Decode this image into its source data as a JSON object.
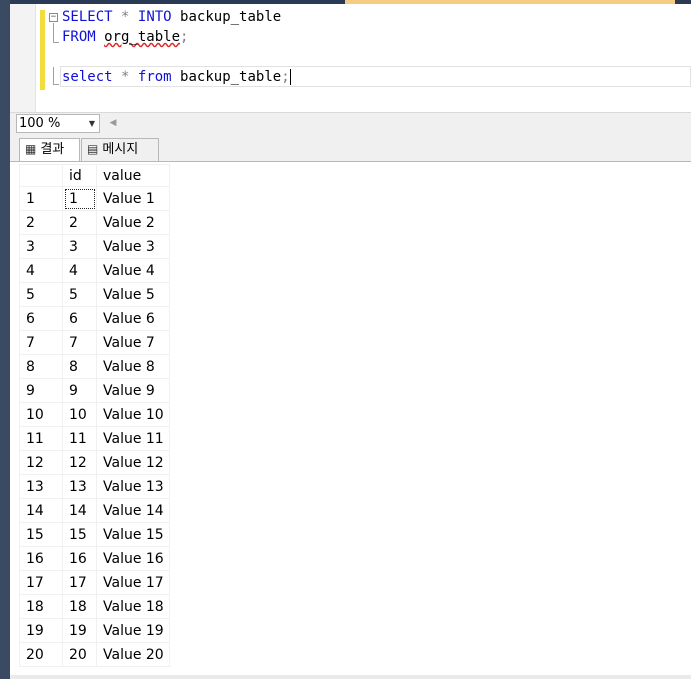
{
  "editor": {
    "line1": {
      "kw1": "SELECT",
      "op": "*",
      "kw2": "INTO",
      "name": "backup_table"
    },
    "line2": {
      "kw": "FROM",
      "name": "org_table",
      "end": ";"
    },
    "line4": {
      "kw1": "select",
      "op": "*",
      "kw2": "from",
      "name": "backup_table",
      "end": ";"
    }
  },
  "toolbar": {
    "zoom": "100 %"
  },
  "results_tabs": [
    {
      "label": "결과",
      "icon": "grid-icon"
    },
    {
      "label": "메시지",
      "icon": "message-icon"
    }
  ],
  "grid": {
    "columns": [
      "id",
      "value"
    ],
    "rows": [
      [
        "1",
        "1",
        "Value 1"
      ],
      [
        "2",
        "2",
        "Value 2"
      ],
      [
        "3",
        "3",
        "Value 3"
      ],
      [
        "4",
        "4",
        "Value 4"
      ],
      [
        "5",
        "5",
        "Value 5"
      ],
      [
        "6",
        "6",
        "Value 6"
      ],
      [
        "7",
        "7",
        "Value 7"
      ],
      [
        "8",
        "8",
        "Value 8"
      ],
      [
        "9",
        "9",
        "Value 9"
      ],
      [
        "10",
        "10",
        "Value 10"
      ],
      [
        "11",
        "11",
        "Value 11"
      ],
      [
        "12",
        "12",
        "Value 12"
      ],
      [
        "13",
        "13",
        "Value 13"
      ],
      [
        "14",
        "14",
        "Value 14"
      ],
      [
        "15",
        "15",
        "Value 15"
      ],
      [
        "16",
        "16",
        "Value 16"
      ],
      [
        "17",
        "17",
        "Value 17"
      ],
      [
        "18",
        "18",
        "Value 18"
      ],
      [
        "19",
        "19",
        "Value 19"
      ],
      [
        "20",
        "20",
        "Value 20"
      ]
    ]
  }
}
